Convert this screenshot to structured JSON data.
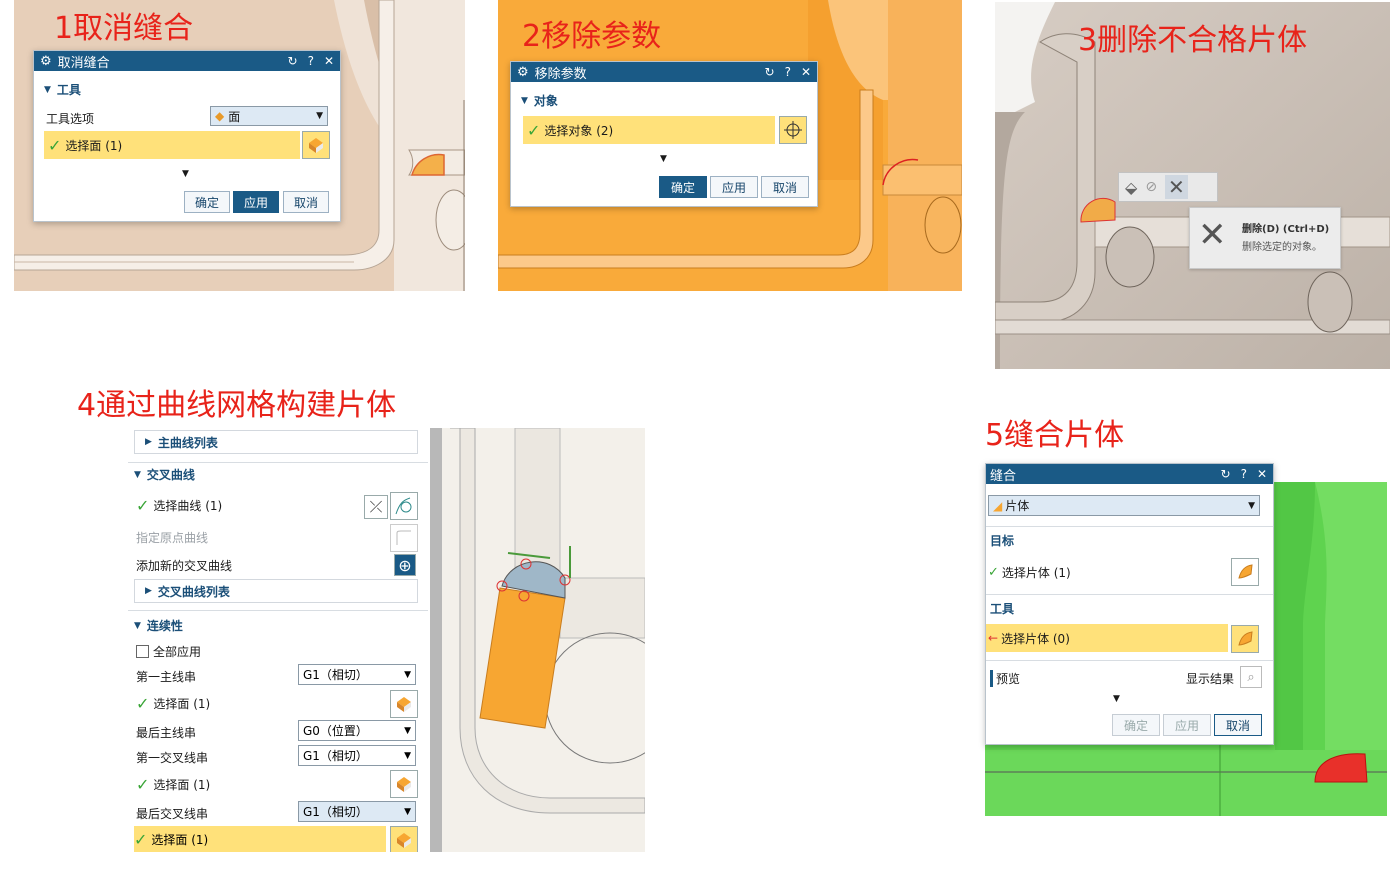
{
  "steps": [
    {
      "title": "1取消缝合"
    },
    {
      "title": "2移除参数"
    },
    {
      "title": "3删除不合格片体"
    },
    {
      "title": "4通过曲线网格构建片体"
    },
    {
      "title": "5缝合片体"
    }
  ],
  "p1": {
    "dialog_title": "取消缝合",
    "section": "工具",
    "tool_option_label": "工具选项",
    "tool_option_value": "面",
    "select_face": "选择面 (1)",
    "ok": "确定",
    "apply": "应用",
    "cancel": "取消"
  },
  "p2": {
    "dialog_title": "移除参数",
    "section": "对象",
    "select_object": "选择对象 (2)",
    "ok": "确定",
    "apply": "应用",
    "cancel": "取消"
  },
  "p3": {
    "tooltip_title": "删除(D) (Ctrl+D)",
    "tooltip_desc": "删除选定的对象。"
  },
  "p4": {
    "primary_list": "主曲线列表",
    "cross_section": "交叉曲线",
    "select_curve": "选择曲线 (1)",
    "origin_curve": "指定原点曲线",
    "add_cross": "添加新的交叉曲线",
    "cross_list": "交叉曲线列表",
    "continuity": "连续性",
    "apply_all": "全部应用",
    "first_primary": "第一主线串",
    "first_primary_val": "G1（相切）",
    "select_face_1": "选择面 (1)",
    "last_primary": "最后主线串",
    "last_primary_val": "G0（位置）",
    "first_cross": "第一交叉线串",
    "first_cross_val": "G1（相切）",
    "select_face_2": "选择面 (1)",
    "last_cross": "最后交叉线串",
    "last_cross_val": "G1（相切）",
    "select_face_3": "选择面 (1)"
  },
  "p5": {
    "dialog_title": "缝合",
    "type_value": "片体",
    "target": "目标",
    "select_target": "选择片体 (1)",
    "tool": "工具",
    "select_tool": "选择片体 (0)",
    "preview": "预览",
    "show_result": "显示结果",
    "ok": "确定",
    "apply": "应用",
    "cancel": "取消"
  },
  "colors": {
    "title_red": "#e8231a",
    "dialog_bar": "#1a5a86",
    "highlight": "#ffe17a",
    "orange": "#f7a632",
    "green": "#5fd34f"
  }
}
